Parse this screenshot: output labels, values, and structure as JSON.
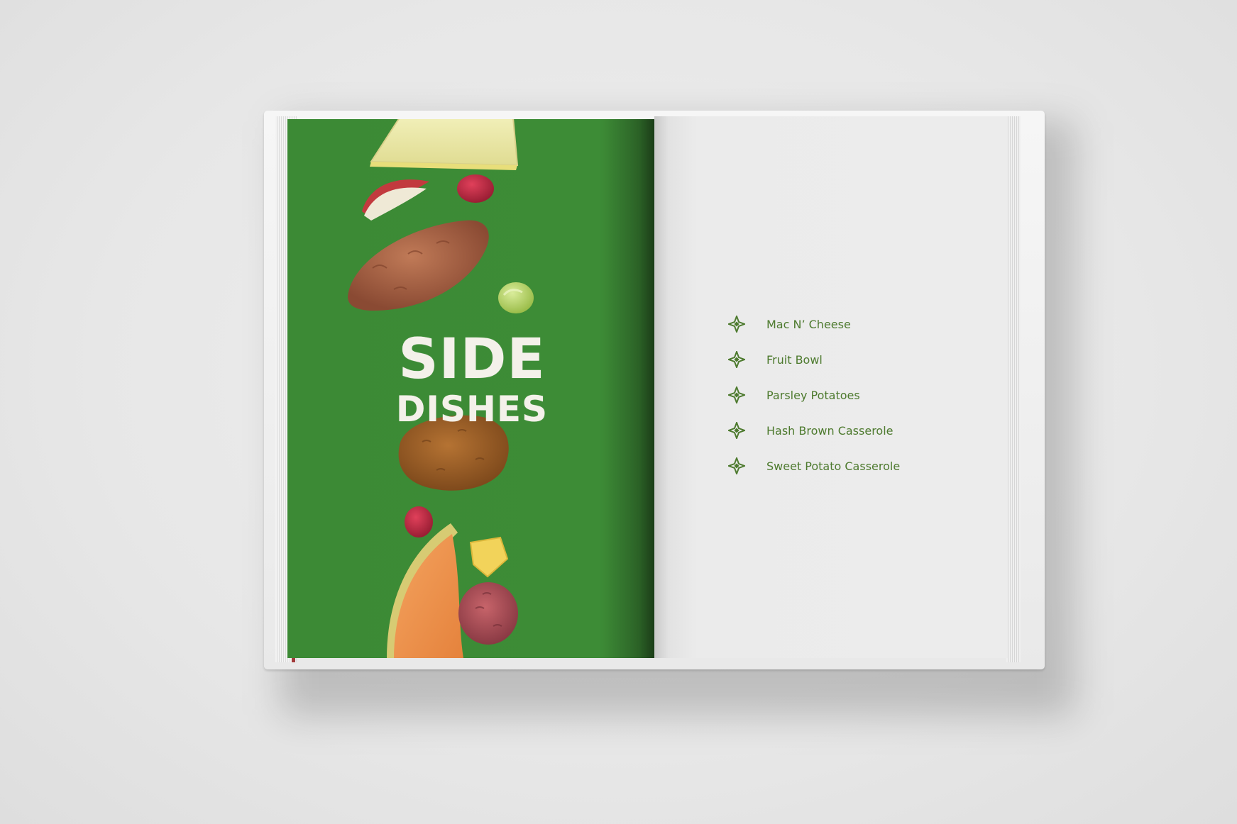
{
  "left_page": {
    "title_line_1": "SIDE",
    "title_line_2": "DISHES",
    "background_color": "#3d8c36",
    "illustrations": [
      "pineapple-wedge",
      "apple-slice",
      "cranberry",
      "sweet-potato",
      "green-grape",
      "potato",
      "cranberry",
      "cantaloupe-slice",
      "pineapple-chunk",
      "red-potato"
    ]
  },
  "right_page": {
    "accent_color": "#4d7a2e",
    "menu_items": [
      {
        "label": "Mac N’ Cheese"
      },
      {
        "label": "Fruit Bowl"
      },
      {
        "label": "Parsley Potatoes"
      },
      {
        "label": "Hash Brown Casserole"
      },
      {
        "label": "Sweet Potato Casserole"
      }
    ]
  }
}
